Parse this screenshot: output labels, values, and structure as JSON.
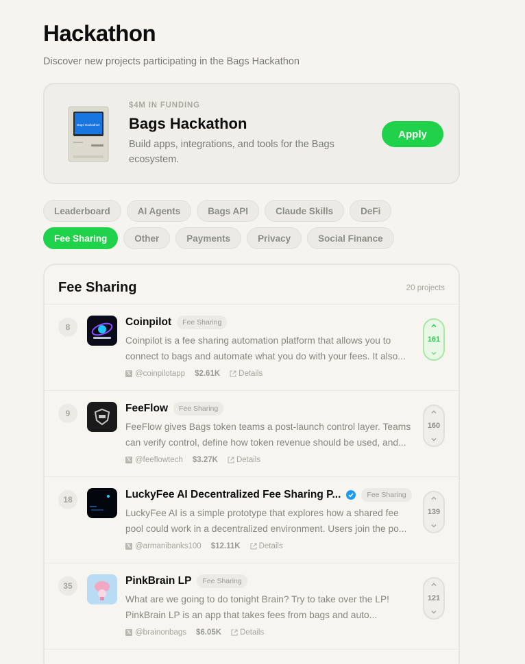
{
  "page": {
    "title": "Hackathon",
    "subtitle": "Discover new projects participating in the Bags Hackathon"
  },
  "hero": {
    "eyebrow": "$4M IN FUNDING",
    "title": "Bags Hackathon",
    "description": "Build apps, integrations, and tools for the Bags ecosystem.",
    "apply_label": "Apply",
    "screen_text": "Bags Hackathon",
    "accent": "#1fd24a"
  },
  "categories": {
    "row1": [
      "Leaderboard",
      "AI Agents",
      "Bags API",
      "Claude Skills",
      "DeFi"
    ],
    "row2": [
      "Fee Sharing",
      "Other",
      "Payments",
      "Privacy",
      "Social Finance"
    ],
    "active": "Fee Sharing"
  },
  "list": {
    "title": "Fee Sharing",
    "count": "20 projects",
    "projects": [
      {
        "rank": "8",
        "name": "Coinpilot",
        "tag": "Fee Sharing",
        "verified": false,
        "description": "Coinpilot is a fee sharing automation platform that allows you to connect to bags and automate what you do with your fees. It also...",
        "handle": "@coinpilotapp",
        "amount": "$2.61K",
        "details_label": "Details",
        "votes": "161",
        "voted": true,
        "logo_icon": "coinpilot-logo"
      },
      {
        "rank": "9",
        "name": "FeeFlow",
        "tag": "Fee Sharing",
        "verified": false,
        "description": "FeeFlow gives Bags token teams a post-launch control layer. Teams can verify control, define how token revenue should be used, and...",
        "handle": "@feeflowtech",
        "amount": "$3.27K",
        "details_label": "Details",
        "votes": "160",
        "voted": false,
        "logo_icon": "feeflow-logo"
      },
      {
        "rank": "18",
        "name": "LuckyFee AI Decentralized Fee Sharing P...",
        "tag": "Fee Sharing",
        "verified": true,
        "description": "LuckyFee AI is a simple prototype that explores how a shared fee pool could work in a decentralized environment. Users join the po...",
        "handle": "@armanibanks100",
        "amount": "$12.11K",
        "details_label": "Details",
        "votes": "139",
        "voted": false,
        "logo_icon": "luckyfee-logo"
      },
      {
        "rank": "35",
        "name": "PinkBrain LP",
        "tag": "Fee Sharing",
        "verified": false,
        "description": "What are we going to do tonight Brain? Try to take over the LP! PinkBrain LP is an app that takes fees from bags and auto...",
        "handle": "@brainonbags",
        "amount": "$6.05K",
        "details_label": "Details",
        "votes": "121",
        "voted": false,
        "logo_icon": "pinkbrain-logo"
      }
    ]
  }
}
